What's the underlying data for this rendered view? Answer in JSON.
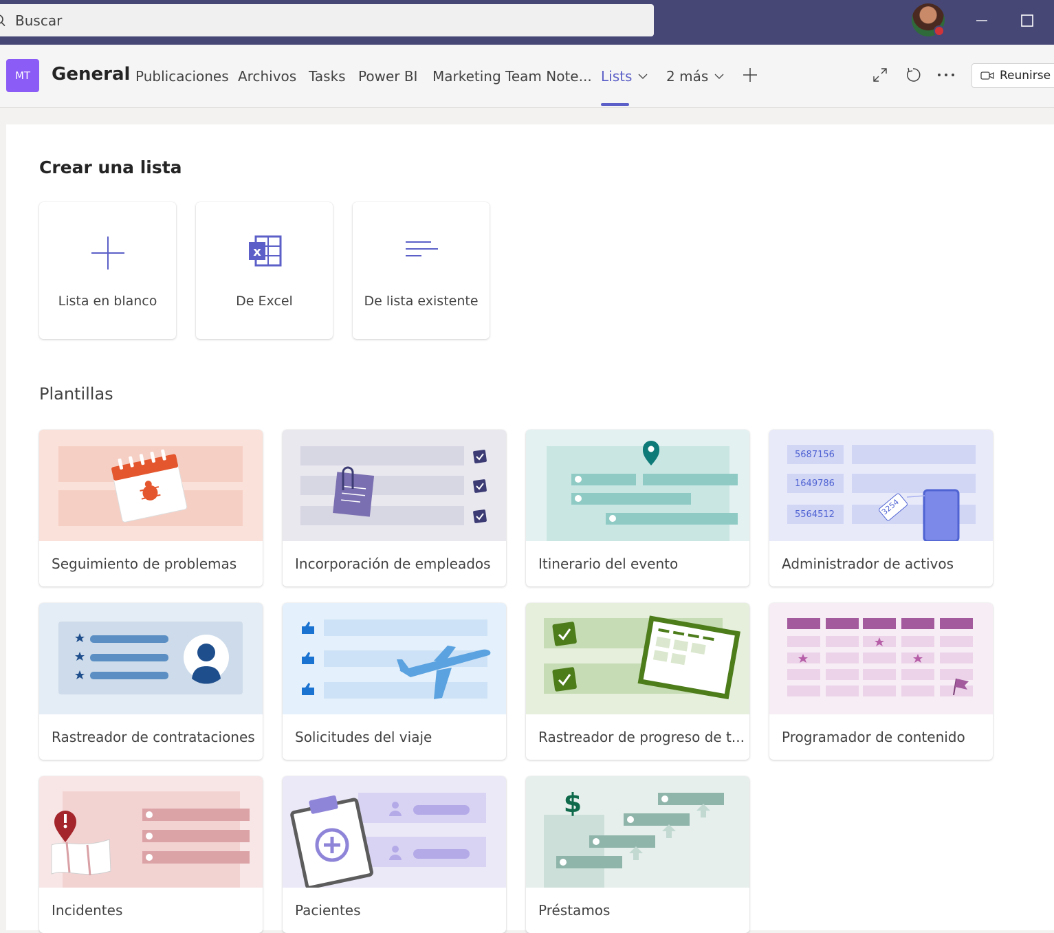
{
  "search": {
    "placeholder": "Buscar"
  },
  "channel": {
    "team_initials": "MT",
    "name": "General",
    "tabs": [
      {
        "label": "Publicaciones"
      },
      {
        "label": "Archivos"
      },
      {
        "label": "Tasks"
      },
      {
        "label": "Power BI"
      },
      {
        "label": "Marketing Team Note..."
      },
      {
        "label": "Lists",
        "active": true
      },
      {
        "label": "2 más"
      }
    ],
    "meet_label": "Reunirse"
  },
  "create": {
    "heading": "Crear una lista",
    "options": [
      {
        "label": "Lista en blanco",
        "icon": "plus-icon"
      },
      {
        "label": "De Excel",
        "icon": "excel-icon"
      },
      {
        "label": "De lista existente",
        "icon": "lines-icon"
      }
    ]
  },
  "templates": {
    "heading": "Plantillas",
    "items": [
      {
        "label": "Seguimiento de problemas"
      },
      {
        "label": "Incorporación de empleados"
      },
      {
        "label": "Itinerario del evento"
      },
      {
        "label": "Administrador de activos",
        "numbers": [
          "5687156",
          "1649786",
          "5564512"
        ],
        "tag": "3254"
      },
      {
        "label": "Rastreador de contrataciones"
      },
      {
        "label": "Solicitudes del viaje"
      },
      {
        "label": "Rastreador de progreso de t..."
      },
      {
        "label": "Programador de contenido"
      },
      {
        "label": "Incidentes"
      },
      {
        "label": "Pacientes"
      },
      {
        "label": "Préstamos"
      }
    ]
  },
  "colors": {
    "titlebar": "#464775",
    "accent": "#5b5fc7",
    "team_badge": "#8b5cf6"
  }
}
